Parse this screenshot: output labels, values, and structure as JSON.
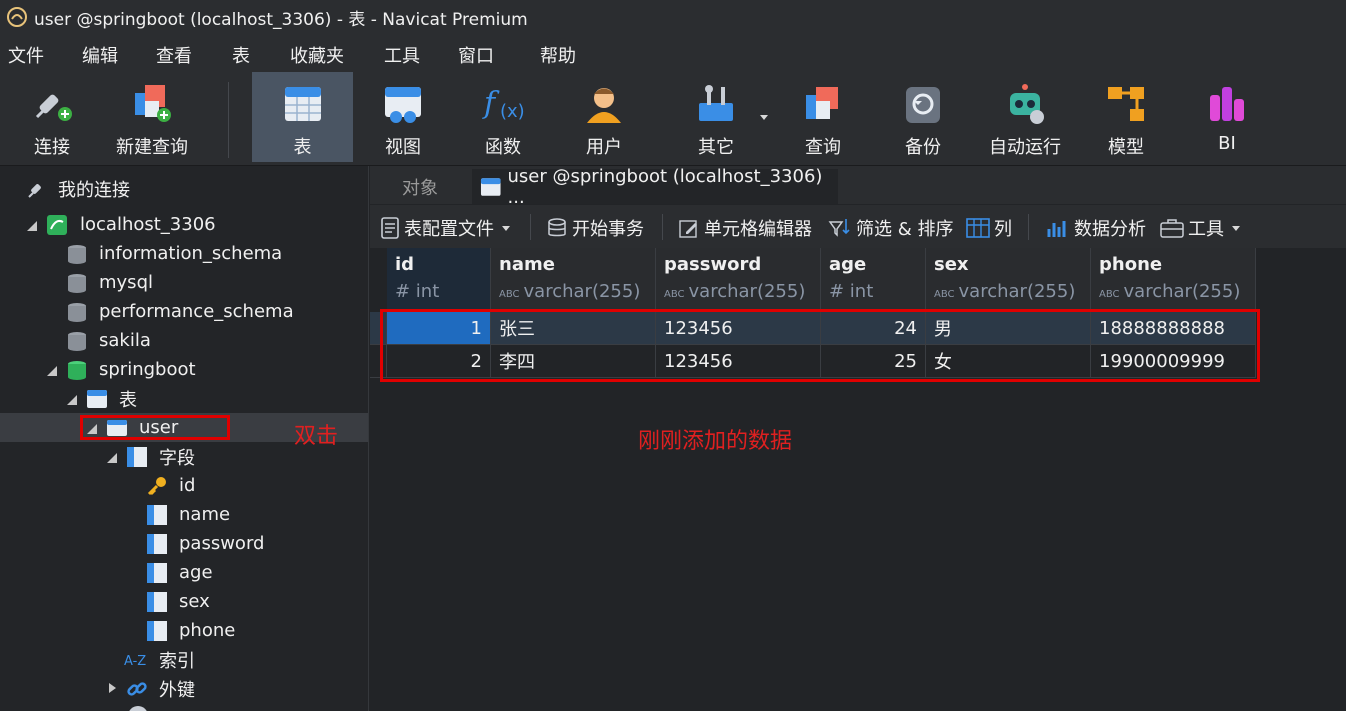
{
  "window": {
    "title": "user @springboot (localhost_3306) - 表 - Navicat Premium"
  },
  "menu": [
    "文件",
    "编辑",
    "查看",
    "表",
    "收藏夹",
    "工具",
    "窗口",
    "帮助"
  ],
  "toolbar": {
    "connect": "连接",
    "new_query": "新建查询",
    "table": "表",
    "view": "视图",
    "function": "函数",
    "user": "用户",
    "other": "其它",
    "query": "查询",
    "backup": "备份",
    "auto_run": "自动运行",
    "model": "模型",
    "bi": "BI"
  },
  "sidebar": {
    "my_connections": "我的连接",
    "connection": "localhost_3306",
    "databases": [
      "information_schema",
      "mysql",
      "performance_schema",
      "sakila",
      "springboot"
    ],
    "tables_folder": "表",
    "table_user": "user",
    "fields_folder": "字段",
    "fields": [
      "id",
      "name",
      "password",
      "age",
      "sex",
      "phone"
    ],
    "indexes": "索引",
    "foreign_keys": "外键"
  },
  "annotation_dblclick": "双击",
  "annotation_new_data": "刚刚添加的数据",
  "tabs": {
    "objects": "对象",
    "active": "user @springboot (localhost_3306) ..."
  },
  "object_toolbar": {
    "profile": "表配置文件",
    "begin_tx": "开始事务",
    "cell_editor": "单元格编辑器",
    "filter_sort": "筛选 & 排序",
    "columns": "列",
    "data_analysis": "数据分析",
    "tools": "工具"
  },
  "grid": {
    "columns": [
      {
        "name": "id",
        "type": "# int"
      },
      {
        "name": "name",
        "type": "varchar(255)"
      },
      {
        "name": "password",
        "type": "varchar(255)"
      },
      {
        "name": "age",
        "type": "# int"
      },
      {
        "name": "sex",
        "type": "varchar(255)"
      },
      {
        "name": "phone",
        "type": "varchar(255)"
      }
    ],
    "type_prefix": "ABC",
    "rows": [
      [
        "1",
        "张三",
        "123456",
        "24",
        "男",
        "18888888888"
      ],
      [
        "2",
        "李四",
        "123456",
        "25",
        "女",
        "19900009999"
      ]
    ]
  },
  "colors": {
    "accent_red": "#e00000",
    "selection_blue": "#1f6bbf"
  }
}
